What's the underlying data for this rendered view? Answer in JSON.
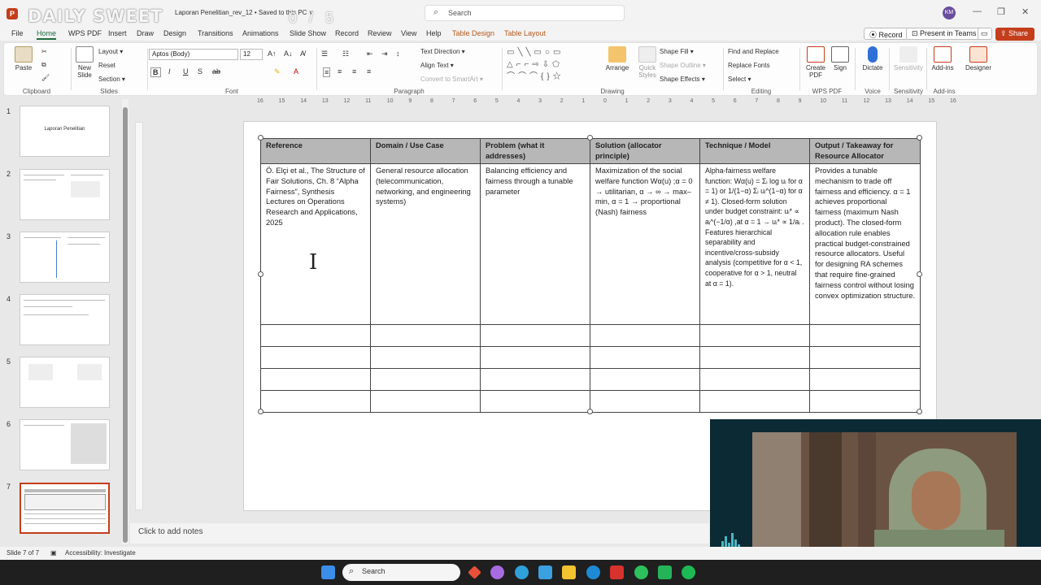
{
  "titlebar": {
    "app_logo": "P",
    "overlay_logo": "DAILY SWEET",
    "overlay_time": "0 / 5",
    "doc_title": "Laporan Penelitian_rev_12 • Saved to this PC ∨",
    "search_placeholder": "Search",
    "avatar": "KM",
    "minimize": "—",
    "restore": "❐",
    "close": "✕"
  },
  "tabs": {
    "items": [
      "File",
      "Home",
      "WPS PDF",
      "Insert",
      "Draw",
      "Design",
      "Transitions",
      "Animations",
      "Slide Show",
      "Record",
      "Review",
      "View",
      "Help",
      "Table Design",
      "Table Layout"
    ],
    "record": "⦿ Record",
    "present": "⊡ Present in Teams",
    "share": "⇪ Share"
  },
  "ribbon": {
    "clipboard": {
      "paste": "Paste",
      "label": "Clipboard"
    },
    "slides": {
      "new_slide": "New Slide",
      "layout": "Layout ▾",
      "reset": "Reset",
      "section": "Section ▾",
      "label": "Slides"
    },
    "font": {
      "family": "Aptos (Body)",
      "size": "12",
      "label": "Font",
      "bold": "B",
      "italic": "I",
      "underline": "U",
      "strike": "S",
      "shadow": "ab"
    },
    "paragraph": {
      "text_direction": "Text Direction ▾",
      "align_text": "Align Text ▾",
      "convert_smartart": "Convert to SmartArt ▾",
      "label": "Paragraph"
    },
    "drawing": {
      "arrange": "Arrange",
      "quick_styles": "Quick Styles",
      "shape_fill": "Shape Fill ▾",
      "shape_outline": "Shape Outline ▾",
      "shape_effects": "Shape Effects ▾",
      "label": "Drawing"
    },
    "editing": {
      "find_replace": "Find and Replace",
      "replace_fonts": "Replace Fonts",
      "select": "Select ▾",
      "label": "Editing"
    },
    "wps": {
      "create_pdf": "Create PDF",
      "sign": "Sign",
      "label": "WPS PDF"
    },
    "voice": {
      "dictate": "Dictate",
      "label": "Voice"
    },
    "sensitivity": {
      "sensitivity": "Sensitivity",
      "label": "Sensitivity"
    },
    "addins": {
      "addins": "Add-ins",
      "designer": "Designer",
      "label": "Add-ins"
    }
  },
  "thumbnails": {
    "numbers": [
      "1",
      "2",
      "3",
      "4",
      "5",
      "6",
      "7"
    ],
    "slide1_title": "Laporan Penelitian"
  },
  "ruler": [
    "16",
    "15",
    "14",
    "13",
    "12",
    "11",
    "10",
    "9",
    "8",
    "7",
    "6",
    "5",
    "4",
    "3",
    "2",
    "1",
    "0",
    "1",
    "2",
    "3",
    "4",
    "5",
    "6",
    "7",
    "8",
    "9",
    "10",
    "11",
    "12",
    "13",
    "14",
    "15",
    "16"
  ],
  "table": {
    "headers": [
      "Reference",
      "Domain / Use Case",
      "Problem (what it addresses)",
      "Solution (allocator principle)",
      "Technique / Model",
      "Output / Takeaway for Resource Allocator"
    ],
    "row": [
      "Ö. Elçi et al., The Structure of Fair Solutions, Ch. 8 “Alpha Fairness”, Synthesis Lectures on Operations Research and Applications, 2025",
      "General resource allocation (telecommunication, networking, and engineering systems)",
      "Balancing efficiency and fairness through a tunable parameter",
      "Maximization of the social welfare function Wα(u) ;α = 0 → utilitarian, α → ∞ → max–min, α = 1 → proportional (Nash) fairness",
      "Alpha-fairness welfare function: Wα(u) = Σᵢ log uᵢ for α = 1) or 1/(1−α) Σᵢ uᵢ^(1−α) for α ≠ 1). Closed-form solution under budget constraint: uᵢ* ∝ aᵢ^(−1/α) ,at α = 1 → uᵢ* ∝ 1/aᵢ . Features hierarchical separability and incentive/cross-subsidy analysis (competitive for α < 1, cooperative for α > 1, neutral at α = 1).",
      "Provides a tunable mechanism to trade off fairness and efficiency. α = 1 achieves proportional fairness (maximum Nash product). The closed-form allocation rule enables practical budget-constrained resource allocators. Useful for designing RA schemes that require fine-grained fairness control without losing convex optimization structure."
    ],
    "empty_rows": 4
  },
  "notes_placeholder": "Click to add notes",
  "status": {
    "slide_count": "Slide 7 of 7",
    "accessibility": "Accessibility: Investigate"
  },
  "taskbar": {
    "search": "Search"
  },
  "colors": {
    "accent": "#c43e1c",
    "home_tab": "#1d6b3e",
    "context_tab": "#b55a1e",
    "header_fill": "#b7b7b7"
  }
}
